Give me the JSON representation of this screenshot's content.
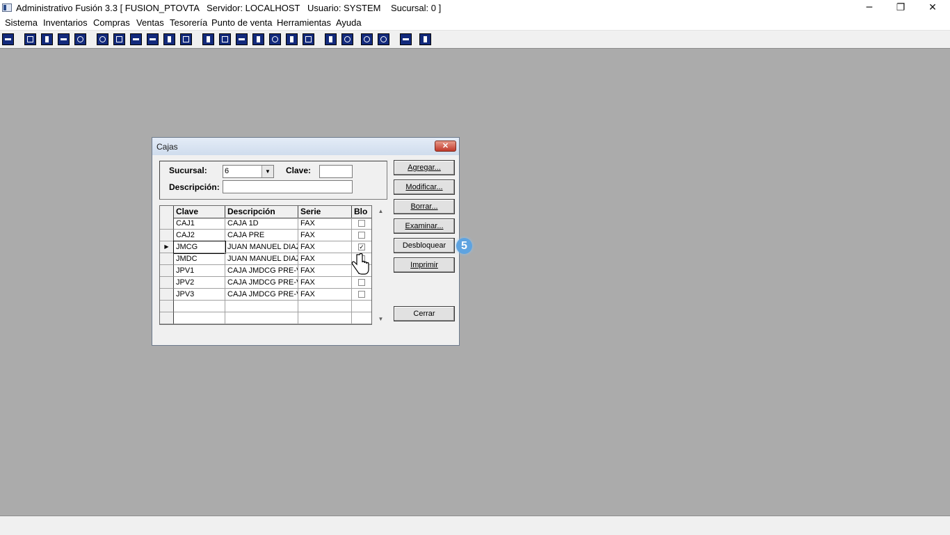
{
  "window": {
    "title": "Administrativo Fusión 3.3 [ FUSION_PTOVTA   Servidor: LOCALHOST   Usuario: SYSTEM    Sucursal: 0 ]",
    "minimize": "─",
    "restore": "❐",
    "close": "✕"
  },
  "menu": [
    "Sistema",
    "Inventarios",
    "Compras",
    "Ventas",
    "Tesorería",
    "Punto de venta",
    "Herramientas",
    "Ayuda"
  ],
  "dialog": {
    "title": "Cajas",
    "close": "✕",
    "sucursal_label": "Sucursal:",
    "sucursal_value": "6",
    "clave_label": "Clave:",
    "clave_value": "",
    "descripcion_label": "Descripción:",
    "descripcion_value": "",
    "columns": [
      "Clave",
      "Descripción",
      "Serie",
      "Blo"
    ],
    "rows": [
      {
        "clave": "CAJ1",
        "descripcion": "CAJA 1D",
        "serie": "FAX",
        "bloqueada": false
      },
      {
        "clave": "CAJ2",
        "descripcion": "CAJA PRE",
        "serie": "FAX",
        "bloqueada": false
      },
      {
        "clave": "JMCG",
        "descripcion": "JUAN MANUEL DIAZ",
        "serie": "FAX",
        "bloqueada": true,
        "selected": true
      },
      {
        "clave": "JMDC",
        "descripcion": "JUAN MANUEL DIAZ",
        "serie": "FAX",
        "bloqueada": false
      },
      {
        "clave": "JPV1",
        "descripcion": "CAJA JMDCG PRE-VE",
        "serie": "FAX",
        "bloqueada": false
      },
      {
        "clave": "JPV2",
        "descripcion": "CAJA JMDCG PRE-VE",
        "serie": "FAX",
        "bloqueada": false
      },
      {
        "clave": "JPV3",
        "descripcion": "CAJA JMDCG PRE-VE",
        "serie": "FAX",
        "bloqueada": false
      }
    ],
    "buttons": {
      "agregar": "Agregar...",
      "modificar": "Modificar...",
      "borrar": "Borrar...",
      "examinar": "Examinar...",
      "desbloquear": "Desbloquear",
      "imprimir": "Imprimir",
      "cerrar": "Cerrar"
    }
  },
  "step_badge": "5"
}
